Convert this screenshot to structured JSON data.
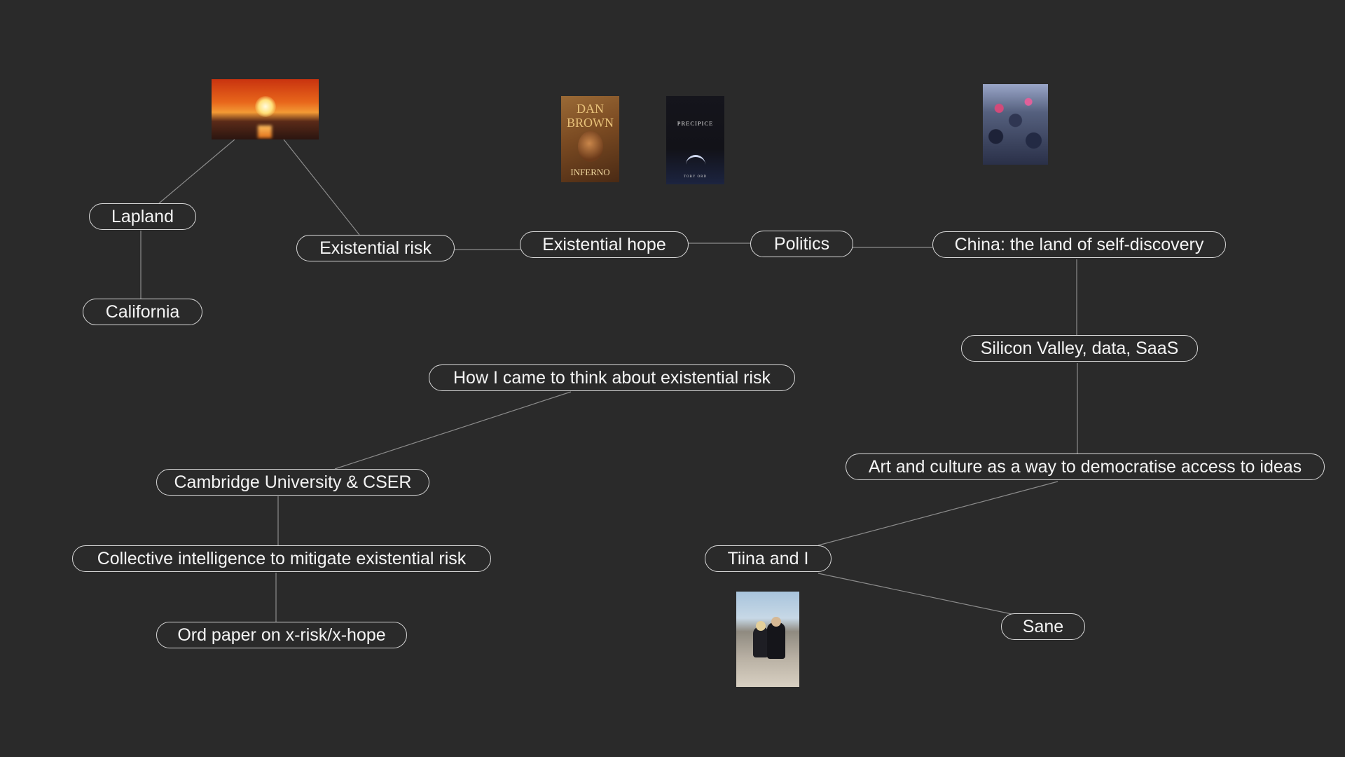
{
  "nodes": {
    "lapland": "Lapland",
    "california": "California",
    "existential_risk": "Existential risk",
    "existential_hope": "Existential hope",
    "politics": "Politics",
    "china": "China: the land of self-discovery",
    "silicon_valley": "Silicon Valley, data, SaaS",
    "how_i_came": "How I came to think about existential risk",
    "cambridge": "Cambridge University & CSER",
    "collective_intelligence": "Collective intelligence to mitigate existential risk",
    "ord_paper": "Ord paper on x-risk/x-hope",
    "art_culture": "Art and culture as a way to democratise access to ideas",
    "tiina": "Tiina and I",
    "sane": "Sane"
  },
  "images": {
    "inferno": {
      "title": "DAN BROWN",
      "subtitle": "INFERNO"
    },
    "precipice": {
      "title": "PRECIPICE",
      "author": "TOBY ORD"
    }
  }
}
